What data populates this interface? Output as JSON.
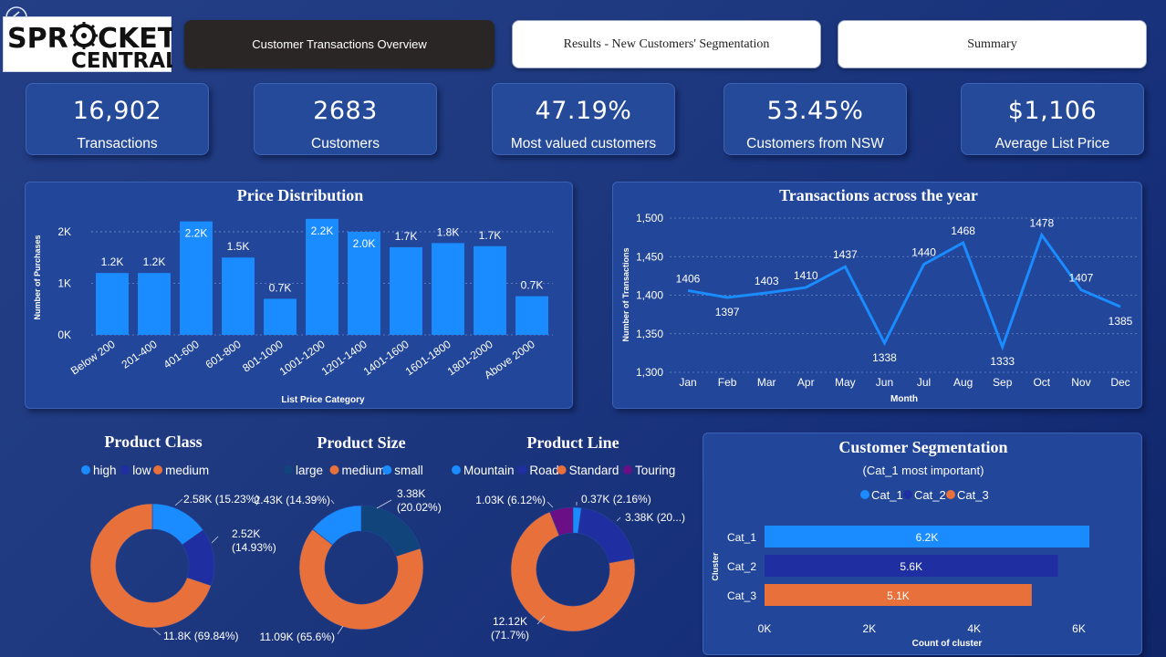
{
  "logo": {
    "line1": "SPR",
    "line1b": "CKET",
    "line2": "CENTRAL"
  },
  "nav": {
    "overview": "Customer Transactions Overview",
    "segmentation": "Results - New Customers' Segmentation",
    "summary": "Summary"
  },
  "kpis": [
    {
      "value": "16,902",
      "label": "Transactions"
    },
    {
      "value": "2683",
      "label": "Customers"
    },
    {
      "value": "47.19%",
      "label": "Most valued customers"
    },
    {
      "value": "53.45%",
      "label": "Customers from NSW"
    },
    {
      "value": "$1,106",
      "label": "Average List Price"
    }
  ],
  "colors": {
    "bar_blue": "#1a8cff",
    "dark_blue": "#1f2ea0",
    "orange": "#e8703a",
    "purple": "#6a0f86",
    "navy": "#11447a",
    "light_blue": "#1aa0ff"
  },
  "chart_data": [
    {
      "type": "bar",
      "title": "Price Distribution",
      "xlabel": "List Price Category",
      "ylabel": "Number of Purchases",
      "categories": [
        "Below 200",
        "201-400",
        "401-600",
        "601-800",
        "801-1000",
        "1001-1200",
        "1201-1400",
        "1401-1600",
        "1601-1800",
        "1801-2000",
        "Above 2000"
      ],
      "values": [
        1200,
        1200,
        2200,
        1500,
        700,
        2250,
        2000,
        1700,
        1780,
        1720,
        750
      ],
      "data_labels": [
        "1.2K",
        "1.2K",
        "2.2K",
        "1.5K",
        "0.7K",
        "2.2K",
        "2.0K",
        "1.7K",
        "1.8K",
        "1.7K",
        "0.7K"
      ],
      "ylim": [
        0,
        2300
      ],
      "yticks": [
        0,
        1000,
        2000
      ],
      "ytick_labels": [
        "0K",
        "1K",
        "2K"
      ],
      "grid": true
    },
    {
      "type": "line",
      "title": "Transactions across the year",
      "xlabel": "Month",
      "ylabel": "Number of Transactions",
      "x": [
        "Jan",
        "Feb",
        "Mar",
        "Apr",
        "May",
        "Jun",
        "Jul",
        "Aug",
        "Sep",
        "Oct",
        "Nov",
        "Dec"
      ],
      "y": [
        1406,
        1397,
        1403,
        1410,
        1437,
        1338,
        1440,
        1468,
        1333,
        1478,
        1407,
        1385
      ],
      "ylim": [
        1300,
        1500
      ],
      "yticks": [
        1300,
        1350,
        1400,
        1450,
        1500
      ],
      "ytick_labels": [
        "1,300",
        "1,350",
        "1,400",
        "1,450",
        "1,500"
      ],
      "grid": true
    },
    {
      "type": "pie",
      "donut": true,
      "title": "Product Class",
      "legend": [
        "high",
        "low",
        "medium"
      ],
      "slices": [
        {
          "name": "high",
          "value": 2.58,
          "label": "2.58K (15.23%)",
          "color": "#1a8cff"
        },
        {
          "name": "low",
          "value": 2.52,
          "label": "2.52K (14.93%)",
          "color": "#1f2ea0"
        },
        {
          "name": "medium",
          "value": 11.8,
          "label": "11.8K (69.84%)",
          "color": "#e8703a"
        }
      ]
    },
    {
      "type": "pie",
      "donut": true,
      "title": "Product Size",
      "legend": [
        "large",
        "medium",
        "small"
      ],
      "slices": [
        {
          "name": "large",
          "value": 3.38,
          "label": "3.38K (20.02%)",
          "color": "#11447a"
        },
        {
          "name": "medium",
          "value": 11.09,
          "label": "11.09K (65.6%)",
          "color": "#e8703a"
        },
        {
          "name": "small",
          "value": 2.43,
          "label": "2.43K (14.39%)",
          "color": "#1a8cff"
        }
      ]
    },
    {
      "type": "pie",
      "donut": true,
      "title": "Product Line",
      "legend": [
        "Mountain",
        "Road",
        "Standard",
        "Touring"
      ],
      "slices": [
        {
          "name": "Mountain",
          "value": 0.37,
          "label": "0.37K (2.16%)",
          "color": "#1a8cff"
        },
        {
          "name": "Road",
          "value": 3.38,
          "label": "3.38K (20...)",
          "color": "#1f2ea0"
        },
        {
          "name": "Standard",
          "value": 12.12,
          "label": "12.12K (71.7%)",
          "color": "#e8703a"
        },
        {
          "name": "Touring",
          "value": 1.03,
          "label": "1.03K (6.12%)",
          "color": "#6a0f86"
        }
      ]
    },
    {
      "type": "bar",
      "orientation": "horizontal",
      "title": "Customer Segmentation",
      "subtitle": "(Cat_1 most important)",
      "xlabel": "Count of cluster",
      "ylabel": "Cluster",
      "legend": [
        "Cat_1",
        "Cat_2",
        "Cat_3"
      ],
      "categories": [
        "Cat_1",
        "Cat_2",
        "Cat_3"
      ],
      "values": [
        6200,
        5600,
        5100
      ],
      "data_labels": [
        "6.2K",
        "5.6K",
        "5.1K"
      ],
      "xlim": [
        0,
        6200
      ],
      "xticks": [
        0,
        2000,
        4000,
        6000
      ],
      "xtick_labels": [
        "0K",
        "2K",
        "4K",
        "6K"
      ],
      "colors": [
        "#1a8cff",
        "#1f2ea0",
        "#e8703a"
      ]
    }
  ]
}
